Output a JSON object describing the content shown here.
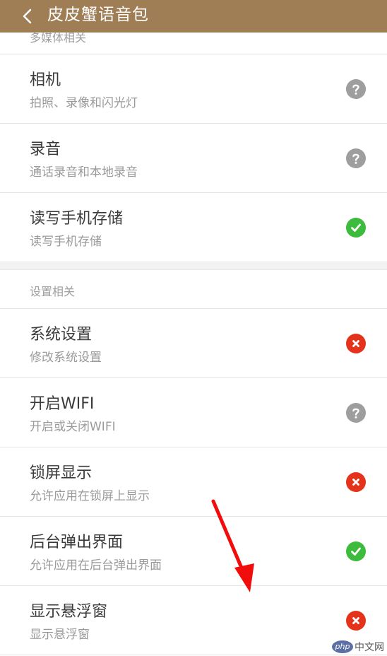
{
  "header": {
    "title": "皮皮蟹语音包"
  },
  "sections": {
    "media": {
      "header": "多媒体相关",
      "rows": [
        {
          "title": "相机",
          "subtitle": "拍照、录像和闪光灯",
          "status": "unknown"
        },
        {
          "title": "录音",
          "subtitle": "通话录音和本地录音",
          "status": "unknown"
        },
        {
          "title": "读写手机存储",
          "subtitle": "读写手机存储",
          "status": "allowed"
        }
      ]
    },
    "settings": {
      "header": "设置相关",
      "rows": [
        {
          "title": "系统设置",
          "subtitle": "修改系统设置",
          "status": "denied"
        },
        {
          "title": "开启WIFI",
          "subtitle": "开启或关闭WIFI",
          "status": "unknown"
        },
        {
          "title": "锁屏显示",
          "subtitle": "允许应用在锁屏上显示",
          "status": "denied"
        },
        {
          "title": "后台弹出界面",
          "subtitle": "允许应用在后台弹出界面",
          "status": "allowed"
        },
        {
          "title": "显示悬浮窗",
          "subtitle": "显示悬浮窗",
          "status": "denied"
        }
      ]
    }
  },
  "status_colors": {
    "unknown": "#9e9e9e",
    "allowed": "#3dbb3d",
    "denied": "#e5321a"
  },
  "header_color": "#a07e55",
  "watermark": {
    "badge": "php",
    "text": "中文网"
  }
}
